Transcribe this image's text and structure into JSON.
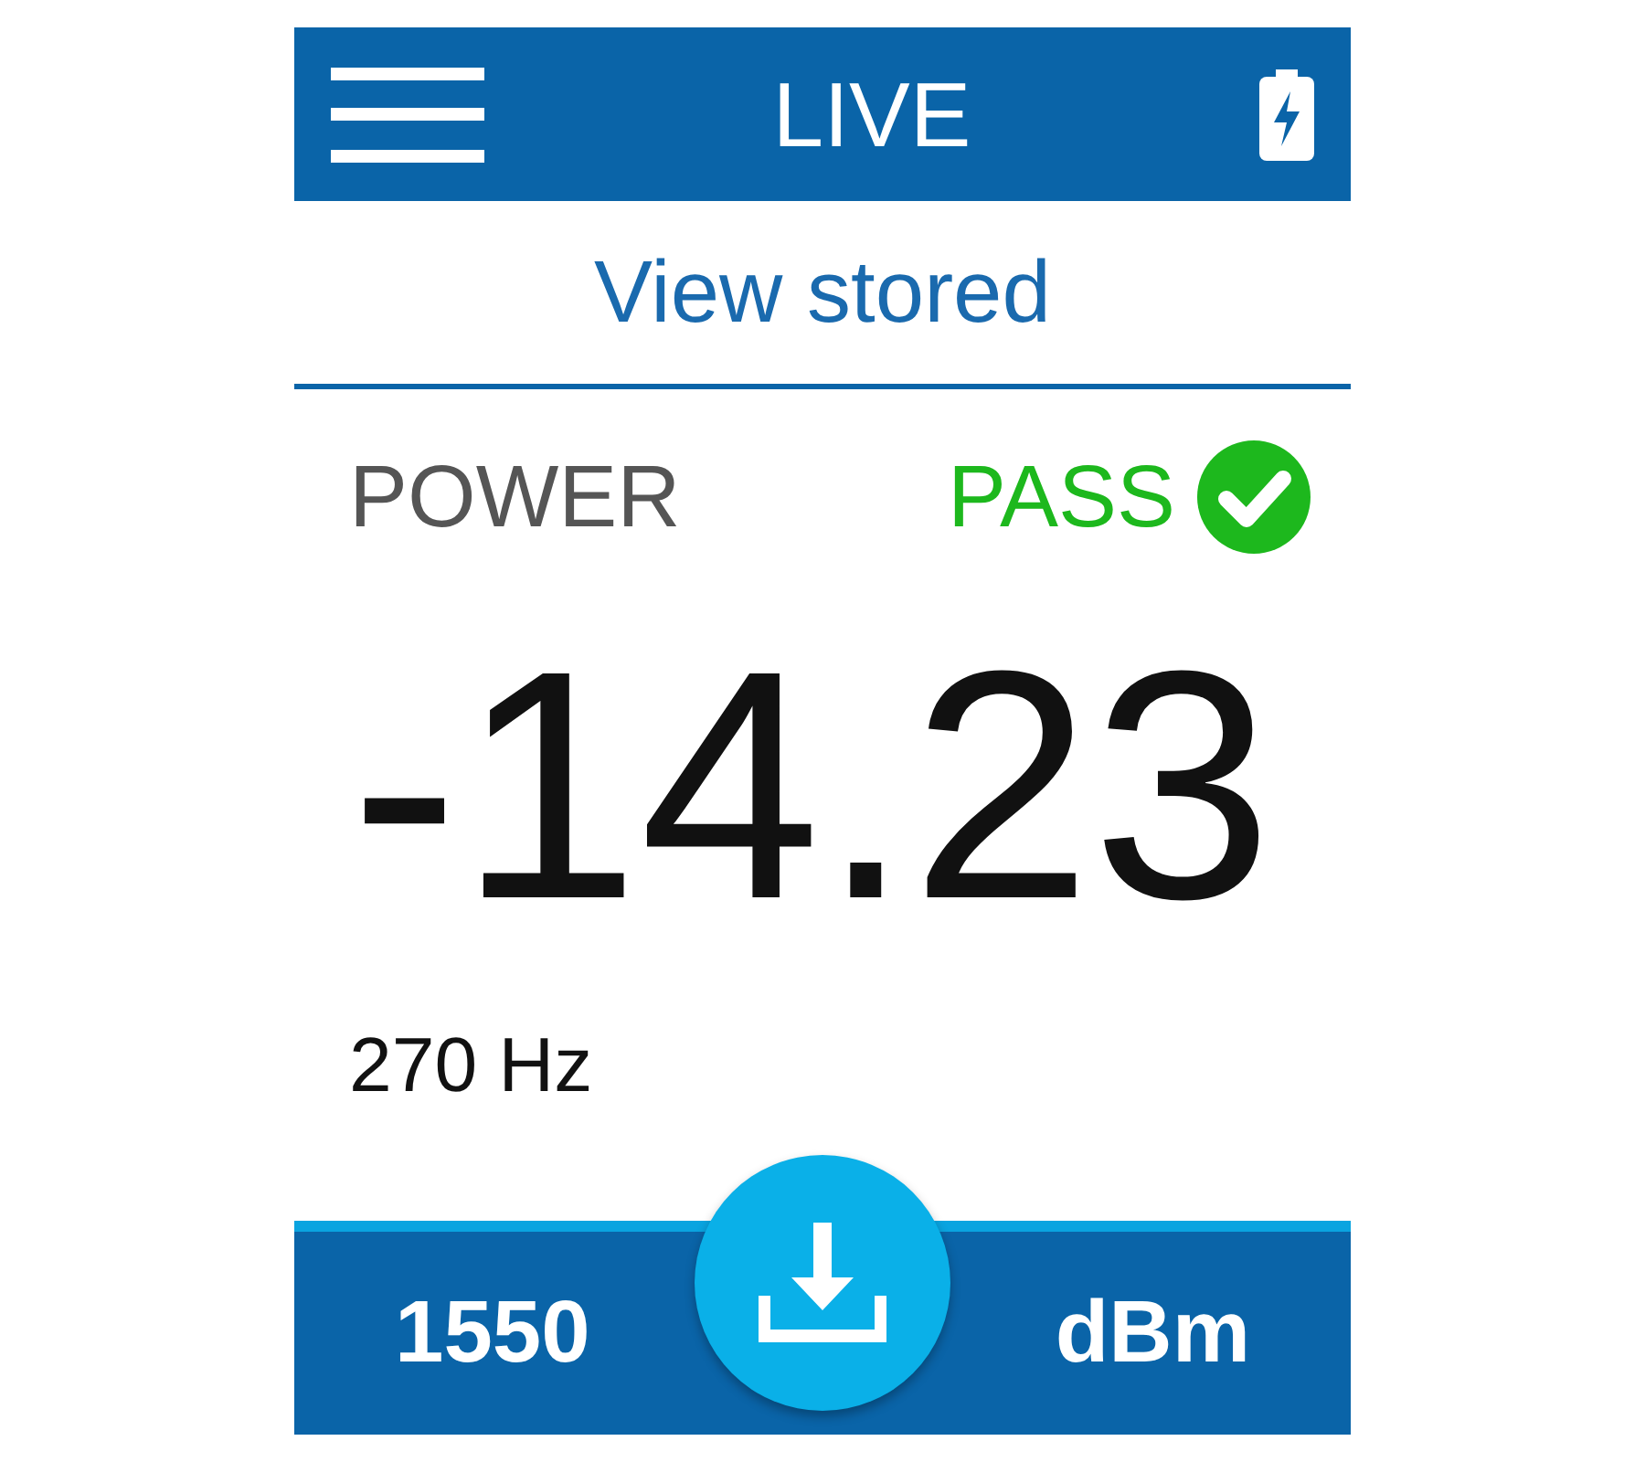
{
  "header": {
    "title": "LIVE"
  },
  "link": {
    "label": "View stored"
  },
  "measurement": {
    "label": "POWER",
    "status": {
      "kind": "pass",
      "text": "PASS"
    },
    "value": "-14.23",
    "frequency": "270 Hz"
  },
  "footer": {
    "wavelength": "1550",
    "unit": "dBm"
  }
}
